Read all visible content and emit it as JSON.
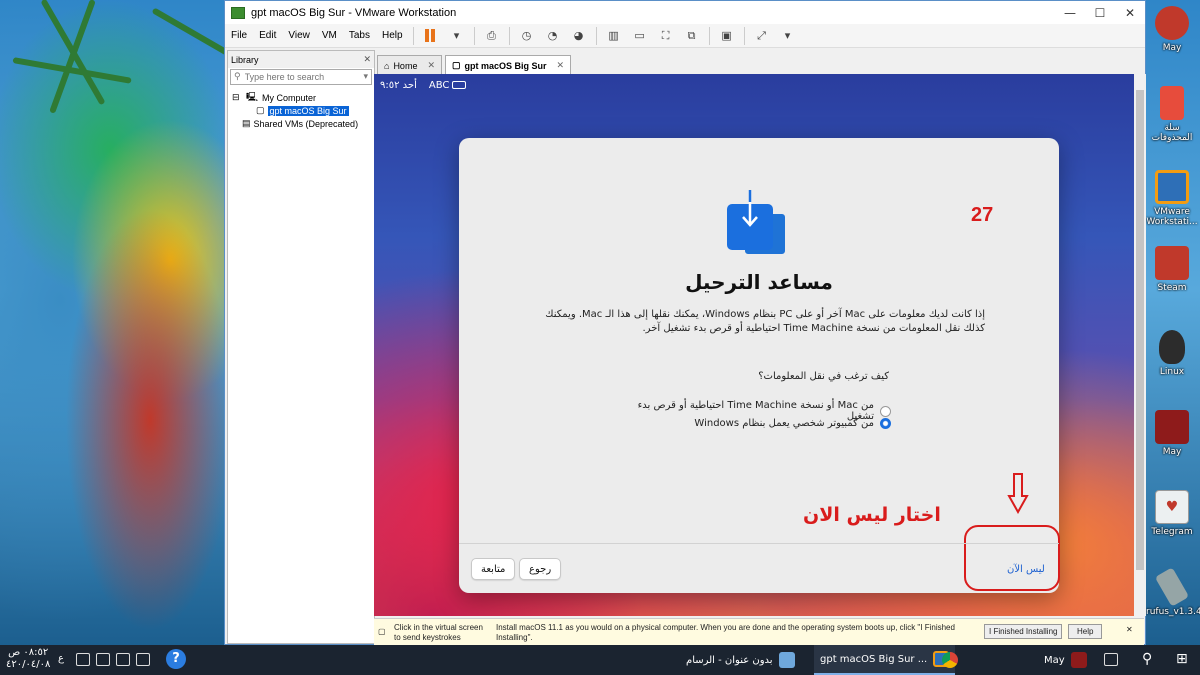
{
  "window": {
    "title": "gpt macOS Big Sur - VMware Workstation",
    "controls": [
      "—",
      "☐",
      "✕"
    ]
  },
  "menu": [
    "File",
    "Edit",
    "View",
    "VM",
    "Tabs",
    "Help"
  ],
  "library": {
    "header": "Library",
    "search_placeholder": "Type here to search",
    "tree": {
      "my_computer": "My Computer",
      "vm": "gpt macOS Big Sur",
      "shared": "Shared VMs (Deprecated)"
    }
  },
  "tabs": [
    {
      "label": "Home"
    },
    {
      "label": "gpt macOS Big Sur"
    }
  ],
  "mac_menubar": {
    "clock": "أحد ٩:٥٢",
    "input": "ABC"
  },
  "dialog": {
    "step": "27",
    "title": "مساعد الترحيل",
    "description": "إذا كانت لديك معلومات على Mac آخر أو على PC بنظام Windows، يمكنك نقلها إلى هذا الـ Mac. ويمكنك كذلك نقل المعلومات من نسخة Time Machine احتياطية أو قرص بدء تشغيل آخر.",
    "question": "كيف ترغب في نقل المعلومات؟",
    "options": [
      {
        "label": "من Mac أو نسخة Time Machine احتياطية أو قرص بدء تشغيل",
        "selected": false
      },
      {
        "label": "من كمبيوتر شخصي يعمل بنظام Windows",
        "selected": true
      }
    ],
    "annotation": "اختار ليس الان",
    "buttons": {
      "continue": "متابعة",
      "back": "رجوع",
      "not_now": "ليس الآن"
    }
  },
  "hint_bar": {
    "click_hint": "Click in the virtual screen to send keystrokes",
    "install_hint": "Install macOS 11.1 as you would on a physical computer. When you are done and the operating system boots up, click \"I Finished Installing\".",
    "finished_button": "I Finished Installing",
    "help_button": "Help"
  },
  "desktop_icons": [
    {
      "label": "May",
      "color": "#c0392b"
    },
    {
      "label": "سلة المحذوفات",
      "color": "#e74c3c"
    },
    {
      "label": "VMware Workstati...",
      "color": "#2e6fb7"
    },
    {
      "label": "Steam",
      "color": "#c0392b"
    },
    {
      "label": "Linux",
      "color": "#333333"
    },
    {
      "label": "May",
      "color": "#8e1b1b"
    },
    {
      "label": "Telegram",
      "color": "#ecf0f1"
    },
    {
      "label": "rufus_v1.3.4",
      "color": "#95a5a6"
    }
  ],
  "taskbar": {
    "time": "٠٨:٥٢ ص",
    "date": "٤٢٠/٠٤/٠٨",
    "lang": "ع",
    "items": [
      {
        "label": "بدون عنوان - الرسام"
      },
      {
        "label": "gpt macOS Big Sur ..."
      }
    ],
    "user": "May"
  },
  "colors": {
    "accent": "#1b6fde",
    "annotation": "#d91c1c"
  }
}
